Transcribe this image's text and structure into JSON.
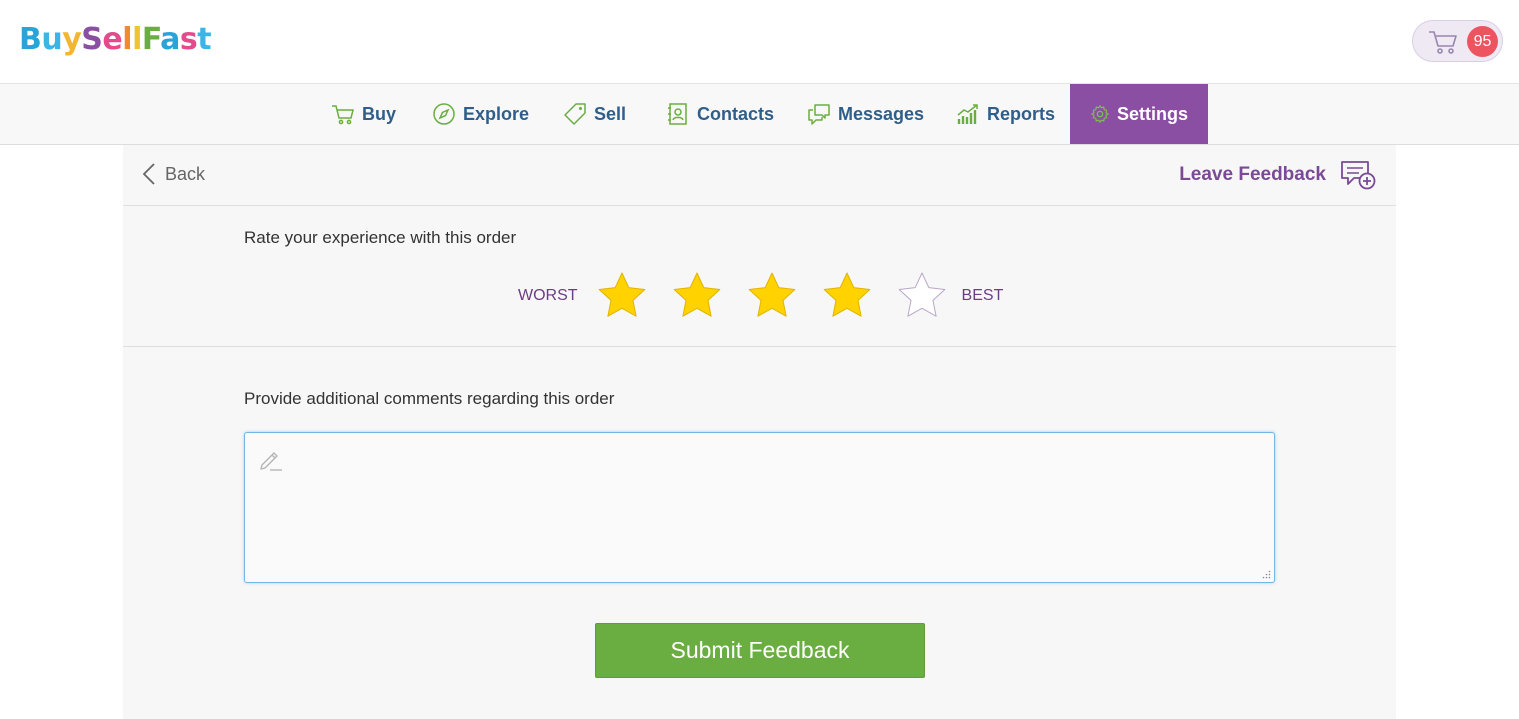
{
  "header": {
    "logo_letters": [
      {
        "ch": "B",
        "color": "#2aa3d8"
      },
      {
        "ch": "u",
        "color": "#3cb4e5"
      },
      {
        "ch": "y",
        "color": "#f2b632"
      },
      {
        "ch": "S",
        "color": "#8a4fa3"
      },
      {
        "ch": "e",
        "color": "#e54b8c"
      },
      {
        "ch": "l",
        "color": "#f08a2b"
      },
      {
        "ch": "l",
        "color": "#f2c230"
      },
      {
        "ch": "F",
        "color": "#6aae41"
      },
      {
        "ch": "a",
        "color": "#2aa3d8"
      },
      {
        "ch": "s",
        "color": "#e54b8c"
      },
      {
        "ch": "t",
        "color": "#3cb4e5"
      }
    ],
    "cart_icon": "shopping-cart-icon",
    "cart_count": "95"
  },
  "nav": {
    "items": [
      {
        "label": "Buy",
        "icon": "cart-icon",
        "active": false
      },
      {
        "label": "Explore",
        "icon": "compass-icon",
        "active": false
      },
      {
        "label": "Sell",
        "icon": "tag-icon",
        "active": false
      },
      {
        "label": "Contacts",
        "icon": "address-book-icon",
        "active": false
      },
      {
        "label": "Messages",
        "icon": "chat-bubbles-icon",
        "active": false
      },
      {
        "label": "Reports",
        "icon": "bar-chart-icon",
        "active": false
      },
      {
        "label": "Settings",
        "icon": "gear-icon",
        "active": true
      }
    ]
  },
  "topbar": {
    "back_label": "Back",
    "title": "Leave Feedback"
  },
  "rating": {
    "prompt": "Rate your experience with this order",
    "low_label": "WORST",
    "high_label": "BEST",
    "value": 4,
    "max": 5
  },
  "comments": {
    "prompt": "Provide additional comments regarding this order",
    "value": ""
  },
  "submit_label": "Submit Feedback",
  "colors": {
    "accent": "#8a4fa3",
    "submit": "#6aae41",
    "star_filled": "#ffd200",
    "badge": "#ee5460"
  }
}
